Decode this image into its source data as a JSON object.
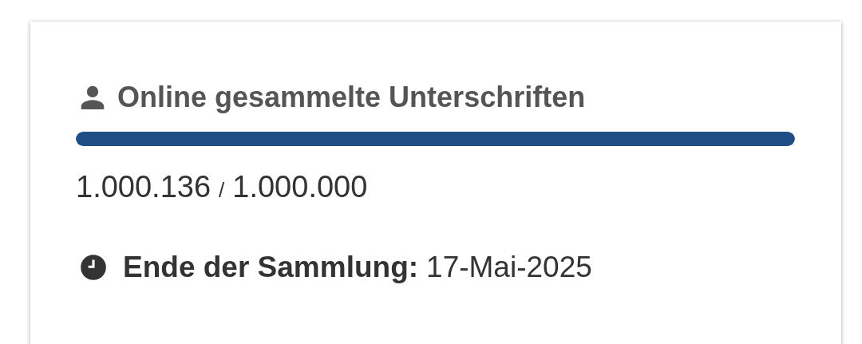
{
  "card": {
    "title": "Online gesammelte Unterschriften",
    "progress": {
      "level": 1
    },
    "count": {
      "collected": "1.000.136",
      "separator": "/",
      "goal": "1.000.000"
    },
    "deadline": {
      "label": "Ende der Sammlung:",
      "value": "17-Mai-2025"
    }
  }
}
